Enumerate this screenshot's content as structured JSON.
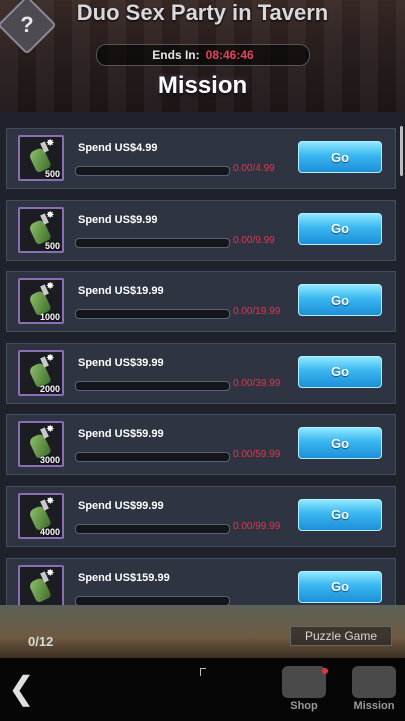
{
  "header": {
    "help_label": "?",
    "event_title": "Duo Sex Party in Tavern",
    "timer_label": "Ends In:",
    "timer_value": "08:46:46",
    "section_title": "Mission"
  },
  "missions": [
    {
      "label": "Spend US$4.99",
      "qty": "500",
      "progress": "0.00/4.99",
      "fill": 0,
      "button": "Go"
    },
    {
      "label": "Spend US$9.99",
      "qty": "500",
      "progress": "0.00/9.99",
      "fill": 0,
      "button": "Go"
    },
    {
      "label": "Spend US$19.99",
      "qty": "1000",
      "progress": "0.00/19.99",
      "fill": 0,
      "button": "Go"
    },
    {
      "label": "Spend US$39.99",
      "qty": "2000",
      "progress": "0.00/39.99",
      "fill": 0,
      "button": "Go"
    },
    {
      "label": "Spend US$59.99",
      "qty": "3000",
      "progress": "0.00/59.99",
      "fill": 0,
      "button": "Go"
    },
    {
      "label": "Spend US$99.99",
      "qty": "4000",
      "progress": "0.00/99.99",
      "fill": 0,
      "button": "Go"
    },
    {
      "label": "Spend US$159.99",
      "qty": "",
      "progress": "",
      "fill": 0,
      "button": "Go"
    }
  ],
  "footer": {
    "count": "0/12",
    "puzzle_label": "Puzzle Game",
    "back_icon": "back-arrow-icon",
    "shop_label": "Shop",
    "mission_label": "Mission"
  },
  "colors": {
    "go_button": "#39b6f0",
    "progress_text": "#e2344b",
    "timer_value": "#e0465a"
  }
}
